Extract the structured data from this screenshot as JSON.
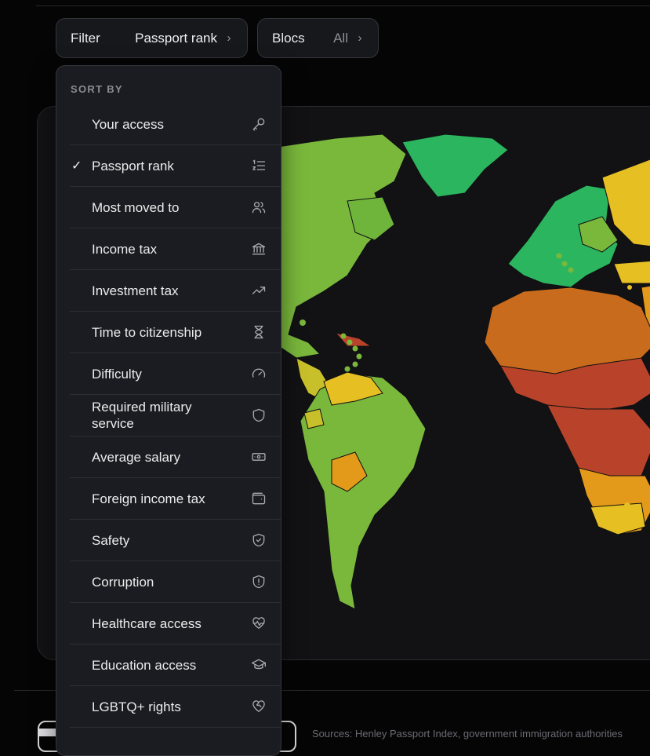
{
  "filter_chip": {
    "key": "Filter",
    "value": "Passport rank",
    "chevron": "chevron-right-icon"
  },
  "blocs_chip": {
    "key": "Blocs",
    "value": "All",
    "chevron": "chevron-right-icon"
  },
  "dropdown": {
    "header": "SORT BY",
    "check_glyph": "✓",
    "items": [
      {
        "label": "Your access",
        "icon": "key-icon",
        "selected": false
      },
      {
        "label": "Passport rank",
        "icon": "ranked-list-icon",
        "selected": true
      },
      {
        "label": "Most moved to",
        "icon": "users-icon",
        "selected": false
      },
      {
        "label": "Income tax",
        "icon": "bank-icon",
        "selected": false
      },
      {
        "label": "Investment tax",
        "icon": "trending-up-icon",
        "selected": false
      },
      {
        "label": "Time to citizenship",
        "icon": "hourglass-icon",
        "selected": false
      },
      {
        "label": "Difficulty",
        "icon": "gauge-icon",
        "selected": false
      },
      {
        "label": "Required military service",
        "icon": "shield-icon",
        "selected": false
      },
      {
        "label": "Average salary",
        "icon": "banknote-icon",
        "selected": false
      },
      {
        "label": "Foreign income tax",
        "icon": "wallet-icon",
        "selected": false
      },
      {
        "label": "Safety",
        "icon": "shield-check-icon",
        "selected": false
      },
      {
        "label": "Corruption",
        "icon": "shield-alert-icon",
        "selected": false
      },
      {
        "label": "Healthcare access",
        "icon": "heart-pulse-icon",
        "selected": false
      },
      {
        "label": "Education access",
        "icon": "graduation-cap-icon",
        "selected": false
      },
      {
        "label": "LGBTQ+ rights",
        "icon": "heart-handshake-icon",
        "selected": false
      }
    ]
  },
  "map": {
    "colors": {
      "best": "#2bb55f",
      "good": "#7ab83c",
      "mid": "#c8c02a",
      "yellow": "#e6bf22",
      "orange": "#e39a1a",
      "darkorange": "#c96b1c",
      "red": "#b8432a",
      "ocean": "#121214"
    }
  },
  "footer": {
    "sources_text": "Sources: Henley Passport Index, government immigration authorities"
  }
}
